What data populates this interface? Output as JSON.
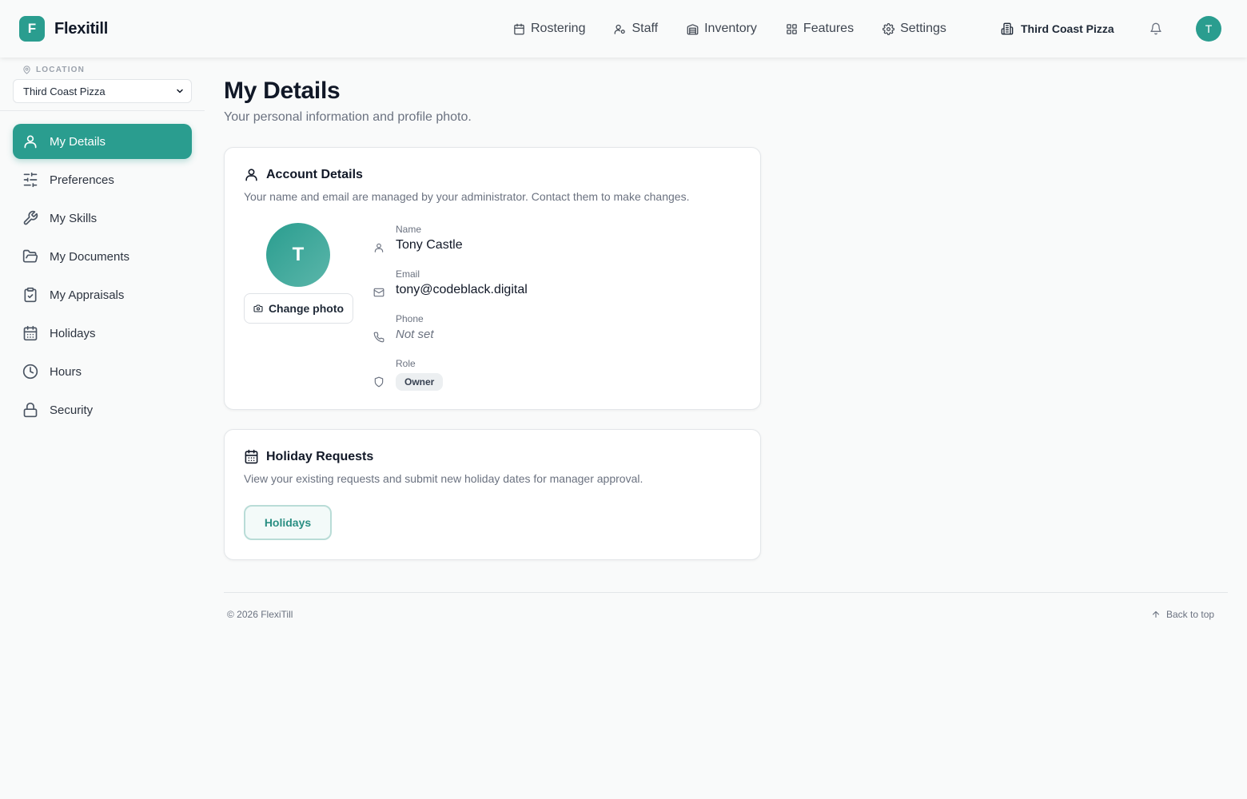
{
  "brand": {
    "logo_letter": "F",
    "name": "Flexitill"
  },
  "nav": [
    {
      "label": "Rostering",
      "icon": "calendar-icon"
    },
    {
      "label": "Staff",
      "icon": "users-icon"
    },
    {
      "label": "Inventory",
      "icon": "warehouse-icon"
    },
    {
      "label": "Features",
      "icon": "grid-icon"
    },
    {
      "label": "Settings",
      "icon": "gear-icon"
    }
  ],
  "header": {
    "org_name": "Third Coast Pizza",
    "avatar_initial": "T"
  },
  "sidebar": {
    "location_label": "LOCATION",
    "location_value": "Third Coast Pizza",
    "items": [
      {
        "label": "My Details",
        "icon": "user-icon",
        "active": true
      },
      {
        "label": "Preferences",
        "icon": "sliders-icon",
        "active": false
      },
      {
        "label": "My Skills",
        "icon": "wrench-icon",
        "active": false
      },
      {
        "label": "My Documents",
        "icon": "folder-icon",
        "active": false
      },
      {
        "label": "My Appraisals",
        "icon": "clipboard-check-icon",
        "active": false
      },
      {
        "label": "Holidays",
        "icon": "calendar-icon",
        "active": false
      },
      {
        "label": "Hours",
        "icon": "clock-icon",
        "active": false
      },
      {
        "label": "Security",
        "icon": "lock-icon",
        "active": false
      }
    ]
  },
  "page": {
    "title": "My Details",
    "subtitle": "Your personal information and profile photo."
  },
  "account": {
    "title": "Account Details",
    "description": "Your name and email are managed by your administrator. Contact them to make changes.",
    "avatar_initial": "T",
    "change_photo_label": "Change photo",
    "fields": {
      "name": {
        "label": "Name",
        "value": "Tony Castle"
      },
      "email": {
        "label": "Email",
        "value": "tony@codeblack.digital"
      },
      "phone": {
        "label": "Phone",
        "value": "Not set"
      },
      "role": {
        "label": "Role",
        "value": "Owner"
      }
    }
  },
  "holiday": {
    "title": "Holiday Requests",
    "description": "View your existing requests and submit new holiday dates for manager approval.",
    "button_label": "Holidays"
  },
  "footer": {
    "copyright": "© 2026 FlexiTill",
    "back_to_top": "Back to top"
  },
  "colors": {
    "accent": "#2a9d8f",
    "background": "#f9fafa",
    "text": "#111827",
    "muted": "#6b7280"
  }
}
